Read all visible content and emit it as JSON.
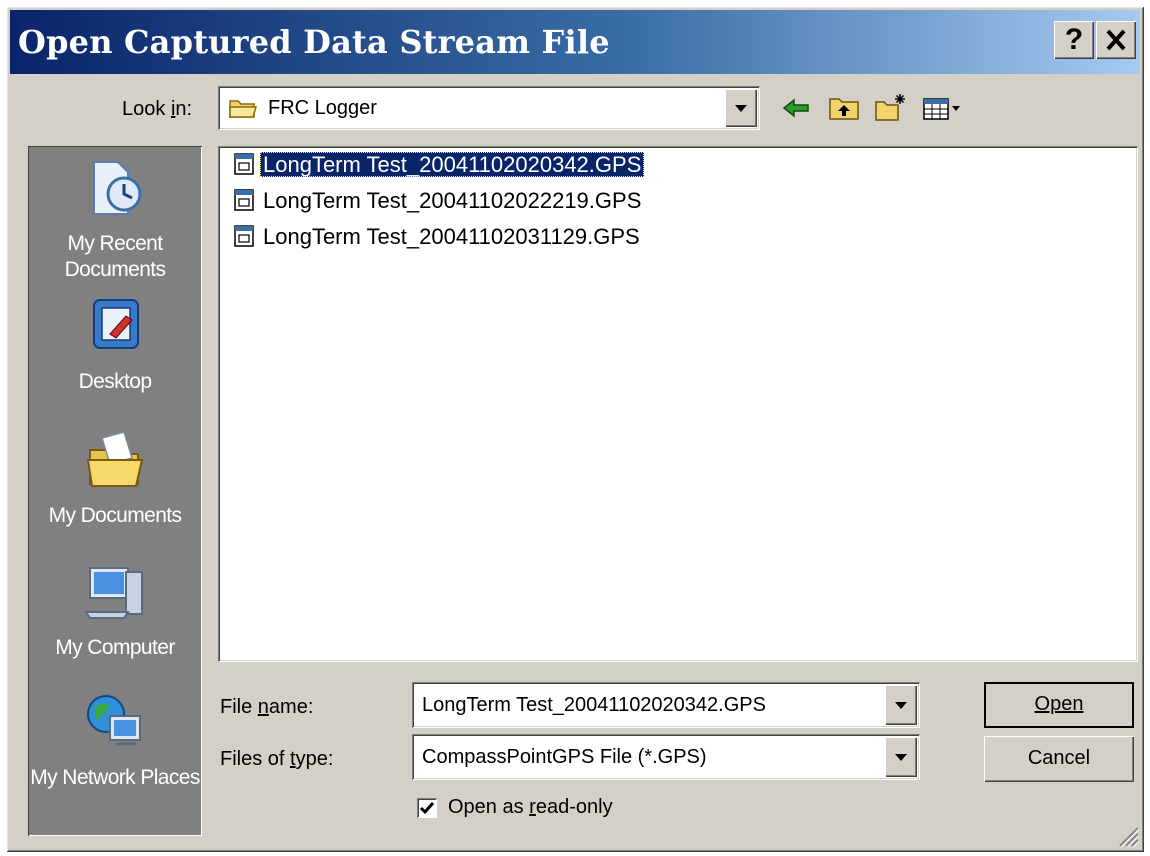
{
  "window": {
    "title": "Open Captured Data Stream File",
    "help_button": "?",
    "close_button": "✕"
  },
  "look_in": {
    "label": "Look in:",
    "value": "FRC Logger"
  },
  "toolbar": {
    "icons": [
      "back-icon",
      "up-folder-icon",
      "new-folder-icon",
      "view-menu-icon"
    ]
  },
  "places": [
    {
      "label": "My Recent Documents",
      "icon": "recent-documents-icon"
    },
    {
      "label": "Desktop",
      "icon": "desktop-icon"
    },
    {
      "label": "My Documents",
      "icon": "my-documents-icon"
    },
    {
      "label": "My Computer",
      "icon": "my-computer-icon"
    },
    {
      "label": "My Network Places",
      "icon": "network-places-icon"
    }
  ],
  "files": [
    {
      "name": "LongTerm Test_20041102020342.GPS",
      "selected": true
    },
    {
      "name": "LongTerm Test_20041102022219.GPS",
      "selected": false
    },
    {
      "name": "LongTerm Test_20041102031129.GPS",
      "selected": false
    }
  ],
  "file_name": {
    "label": "File name:",
    "value": "LongTerm Test_20041102020342.GPS"
  },
  "file_type": {
    "label": "Files of type:",
    "value": "CompassPointGPS File (*.GPS)"
  },
  "read_only": {
    "label": "Open as read-only",
    "checked": true
  },
  "buttons": {
    "open": "Open",
    "cancel": "Cancel"
  },
  "colors": {
    "title_start": "#0a246a",
    "title_end": "#a6caf0",
    "face": "#d4d0c8",
    "places_bg": "#808080",
    "selection": "#0a246a"
  }
}
